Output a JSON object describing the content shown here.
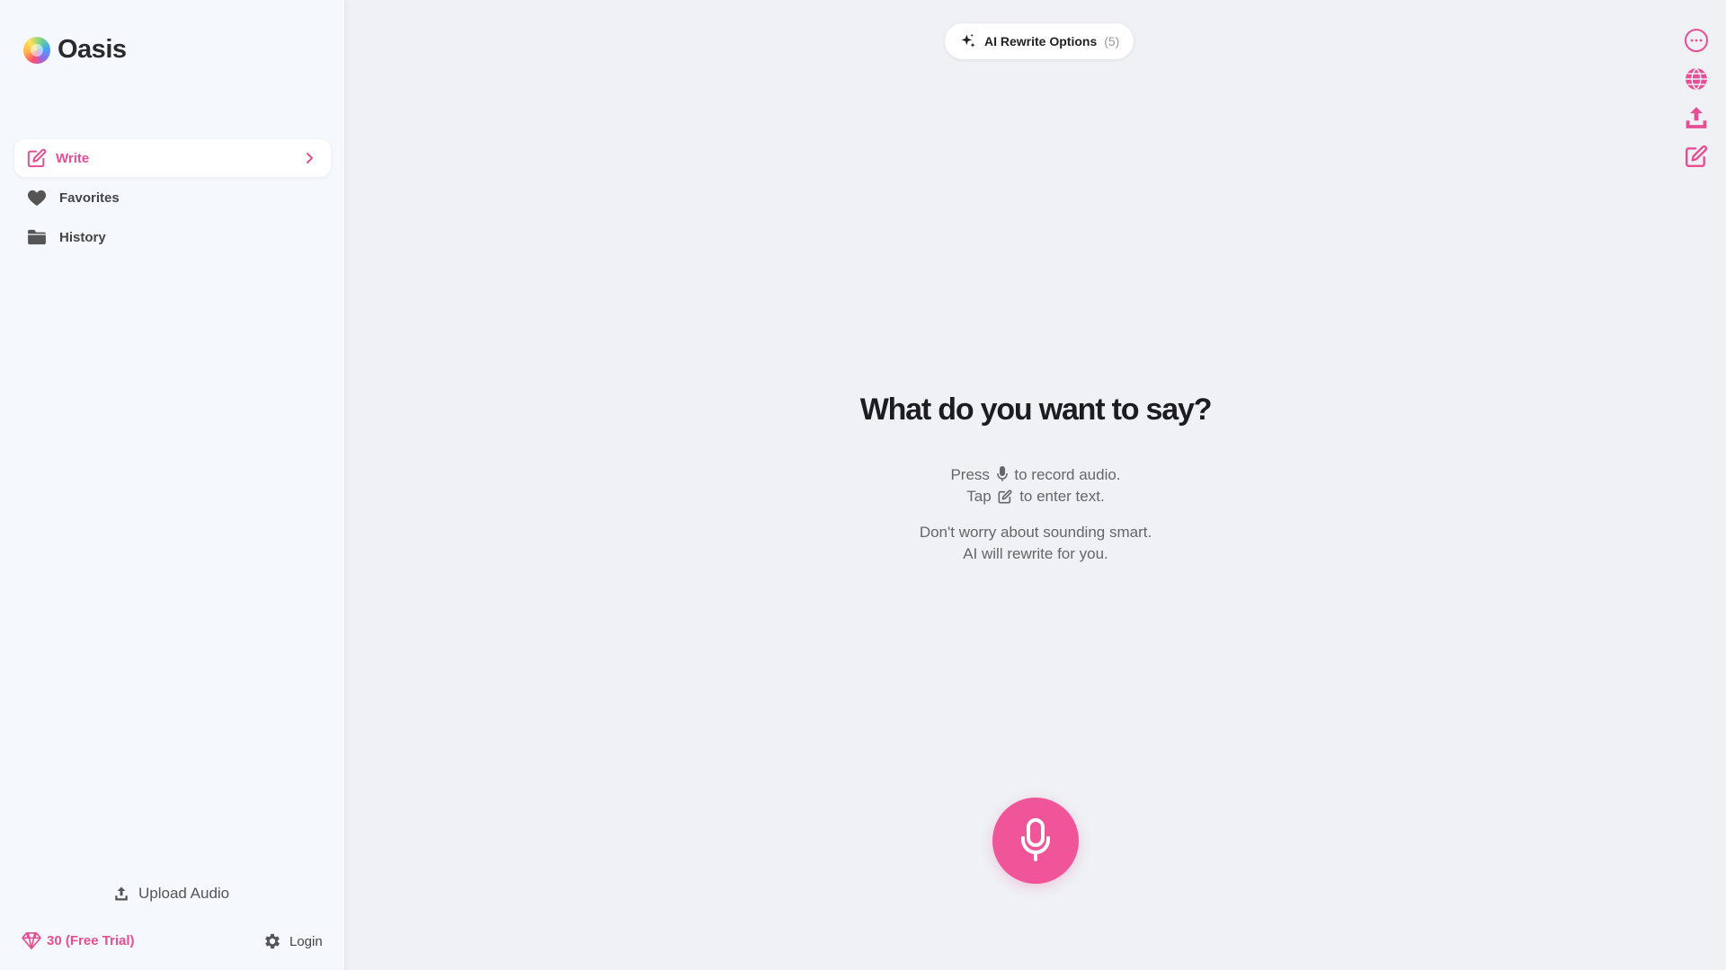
{
  "app": {
    "name": "Oasis"
  },
  "sidebar": {
    "items": [
      {
        "label": "Write",
        "icon": "edit-icon",
        "active": true
      },
      {
        "label": "Favorites",
        "icon": "heart-icon",
        "active": false
      },
      {
        "label": "History",
        "icon": "folder-icon",
        "active": false
      }
    ],
    "upload_audio": "Upload Audio",
    "credits": "30 (Free Trial)",
    "login": "Login"
  },
  "toolbar": {
    "rewrite_label": "AI Rewrite Options",
    "rewrite_count": "(5)",
    "icons": [
      "more-icon",
      "globe-icon",
      "upload-icon",
      "edit-icon"
    ]
  },
  "main": {
    "headline": "What do you want to say?",
    "hint_press_before": "Press",
    "hint_press_after": "to record audio.",
    "hint_tap_before": "Tap",
    "hint_tap_after": "to enter text.",
    "hint_worry": "Don't worry about sounding smart.",
    "hint_ai": "AI will rewrite for you."
  },
  "colors": {
    "accent": "#f0559a",
    "accent_text": "#e74e93",
    "sidebar_bg": "#f5f8fc",
    "main_bg": "#eff1f5"
  }
}
